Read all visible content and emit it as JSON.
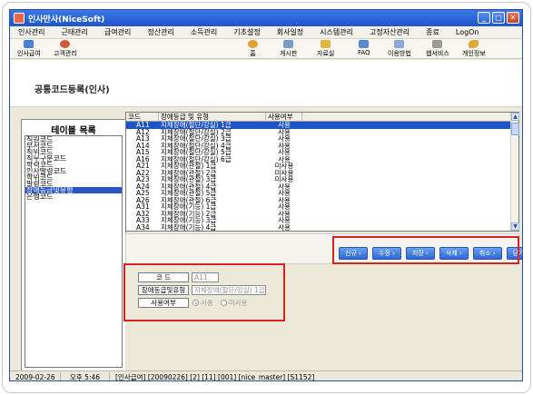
{
  "window": {
    "title": "인사만사(NiceSoft)"
  },
  "menu": [
    "인사관리",
    "근태관리",
    "급여관리",
    "정산관리",
    "소득관리",
    "기초설정",
    "회사일정",
    "시스템관리",
    "고정자산관리",
    "종료",
    "LogOn"
  ],
  "toolbar": {
    "left": [
      {
        "label": "인사급여",
        "icon": "person-payroll-icon"
      },
      {
        "label": "고객관리",
        "icon": "customer-icon"
      }
    ],
    "right": [
      {
        "label": "홈",
        "icon": "home-icon"
      },
      {
        "label": "게시판",
        "icon": "board-icon"
      },
      {
        "label": "자료실",
        "icon": "archive-icon"
      },
      {
        "label": "FAQ",
        "icon": "faq-icon"
      },
      {
        "label": "이용방법",
        "icon": "help-icon"
      },
      {
        "label": "웹서비스",
        "icon": "web-service-icon"
      },
      {
        "label": "개인정보",
        "icon": "personal-info-icon"
      }
    ]
  },
  "page_title": "공통코드등록(인사)",
  "table_list": {
    "title": "테이블 목록",
    "items": [
      "직원코드",
      "부서코드",
      "직위코드",
      "직무구분코드",
      "학력코드",
      "인사발령코드",
      "학위코드",
      "발령코드",
      "장애등급및유형",
      "은행코드"
    ],
    "selected_index": 8
  },
  "grid": {
    "headers": {
      "code": "코드",
      "name": "장애등급 및 유형",
      "use": "사용여부"
    },
    "rows": [
      {
        "code": "A11",
        "name": "지체장애(절단/강실) 1급",
        "use": "사용"
      },
      {
        "code": "A12",
        "name": "지체장애(절단/강실) 2급",
        "use": "사용"
      },
      {
        "code": "A13",
        "name": "지체장애(절단/강실) 3급",
        "use": "사용"
      },
      {
        "code": "A14",
        "name": "지체장애(절단/강실) 4급",
        "use": "사용"
      },
      {
        "code": "A15",
        "name": "지체장애(절단/강실) 5급",
        "use": "사용"
      },
      {
        "code": "A16",
        "name": "지체장애(절단/강실) 6급",
        "use": "사용"
      },
      {
        "code": "A21",
        "name": "지체장애(관절) 1급",
        "use": "미사용"
      },
      {
        "code": "A22",
        "name": "지체장애(관절) 2급",
        "use": "미사용"
      },
      {
        "code": "A23",
        "name": "지체장애(관절) 3급",
        "use": "미사용"
      },
      {
        "code": "A24",
        "name": "지체장애(관절) 4급",
        "use": "사용"
      },
      {
        "code": "A25",
        "name": "지체장애(관절) 5급",
        "use": "사용"
      },
      {
        "code": "A26",
        "name": "지체장애(관절) 6급",
        "use": "사용"
      },
      {
        "code": "A31",
        "name": "지체장애(기능) 1급",
        "use": "사용"
      },
      {
        "code": "A32",
        "name": "지체장애(기능) 2급",
        "use": "사용"
      },
      {
        "code": "A33",
        "name": "지체장애(기능) 3급",
        "use": "사용"
      },
      {
        "code": "A34",
        "name": "지체장애(기능) 4급",
        "use": "사용"
      }
    ],
    "selected_index": 0
  },
  "actions": [
    "신규",
    "수정",
    "저장",
    "삭제",
    "취소",
    "닫기"
  ],
  "form": {
    "code_label": "코    드",
    "code_value": "A11",
    "name_label": "장애등급및유형",
    "name_value": "지체장애(절단/강실) 1급",
    "use_label": "사용여부",
    "use_option": "사용",
    "unuse_option": "미사용"
  },
  "status": {
    "date": "2009-02-26",
    "time": "오후 5:46",
    "info": "[인사급여] [20090226] [2] [11] [001] [nice_master] [S1152]"
  },
  "colors": {
    "title_bar": "#1f56c9",
    "highlight": "#e02020",
    "selected_row": "#1f54c8"
  }
}
